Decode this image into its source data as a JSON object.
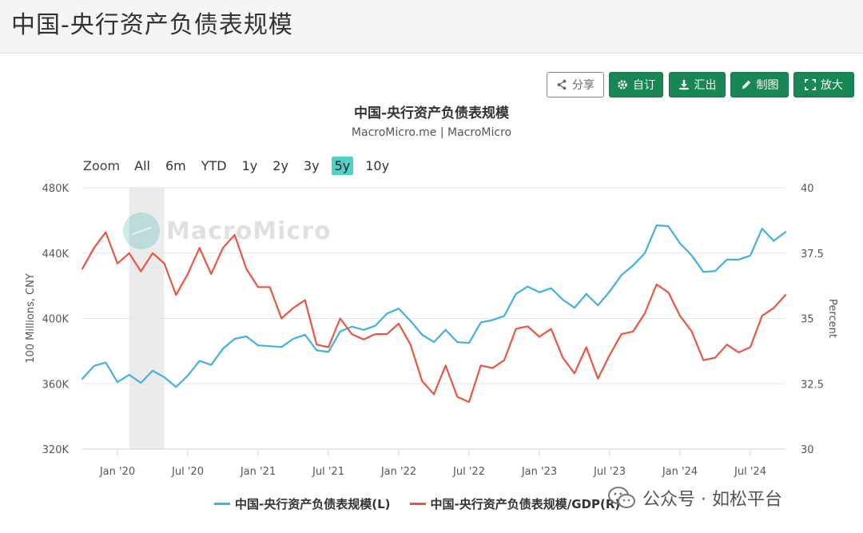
{
  "page": {
    "title": "中国-央行资产负债表规模"
  },
  "toolbar": {
    "share_label": "分享",
    "custom_label": "自订",
    "export_label": "汇出",
    "draw_label": "制图",
    "enlarge_label": "放大"
  },
  "zoom": {
    "label": "Zoom",
    "options": [
      "All",
      "6m",
      "YTD",
      "1y",
      "2y",
      "3y",
      "5y",
      "10y"
    ],
    "active": "5y"
  },
  "watermark": {
    "text": "MacroMicro"
  },
  "wechat": {
    "text": "公众号 · 如松平台"
  },
  "colors": {
    "left_series": "#3fb1e3",
    "right_series": "#e8563f",
    "recession_band": "#ebebeb",
    "active_zoom": "#4fd1c5",
    "button_green": "#198754"
  },
  "chart_data": {
    "type": "line",
    "title": "中国-央行资产负债表规模",
    "subtitle": "MacroMicro.me | MacroMicro",
    "ylabel_left": "100 Millions, CNY",
    "ylabel_right": "Percent",
    "ylim_left": [
      320000,
      480000
    ],
    "ylim_right": [
      30,
      40
    ],
    "yticks_left": [
      "320K",
      "360K",
      "400K",
      "440K",
      "480K"
    ],
    "yticks_right": [
      "30",
      "32.5",
      "35",
      "37.5",
      "40"
    ],
    "yticks_left_values": [
      320000,
      360000,
      400000,
      440000,
      480000
    ],
    "yticks_right_values": [
      30,
      32.5,
      35,
      37.5,
      40
    ],
    "xlim": [
      "2019-10",
      "2024-10"
    ],
    "xticks": [
      {
        "date": "2020-01",
        "label": "Jan '20"
      },
      {
        "date": "2020-07",
        "label": "Jul '20"
      },
      {
        "date": "2021-01",
        "label": "Jan '21"
      },
      {
        "date": "2021-07",
        "label": "Jul '21"
      },
      {
        "date": "2022-01",
        "label": "Jan '22"
      },
      {
        "date": "2022-07",
        "label": "Jul '22"
      },
      {
        "date": "2023-01",
        "label": "Jan '23"
      },
      {
        "date": "2023-07",
        "label": "Jul '23"
      },
      {
        "date": "2024-01",
        "label": "Jan '24"
      },
      {
        "date": "2024-07",
        "label": "Jul '24"
      }
    ],
    "grid": true,
    "legend_position": "bottom",
    "shaded_periods": [
      {
        "start": "2020-02",
        "end": "2020-05"
      }
    ],
    "dates": [
      "2019-10",
      "2019-11",
      "2019-12",
      "2020-01",
      "2020-02",
      "2020-03",
      "2020-04",
      "2020-05",
      "2020-06",
      "2020-07",
      "2020-08",
      "2020-09",
      "2020-10",
      "2020-11",
      "2020-12",
      "2021-01",
      "2021-02",
      "2021-03",
      "2021-04",
      "2021-05",
      "2021-06",
      "2021-07",
      "2021-08",
      "2021-09",
      "2021-10",
      "2021-11",
      "2021-12",
      "2022-01",
      "2022-02",
      "2022-03",
      "2022-04",
      "2022-05",
      "2022-06",
      "2022-07",
      "2022-08",
      "2022-09",
      "2022-10",
      "2022-11",
      "2022-12",
      "2023-01",
      "2023-02",
      "2023-03",
      "2023-04",
      "2023-05",
      "2023-06",
      "2023-07",
      "2023-08",
      "2023-09",
      "2023-10",
      "2023-11",
      "2023-12",
      "2024-01",
      "2024-02",
      "2024-03",
      "2024-04",
      "2024-05",
      "2024-06",
      "2024-07",
      "2024-08",
      "2024-09",
      "2024-10"
    ],
    "series": [
      {
        "name": "中国-央行资产负债表规模(L)",
        "axis": "left",
        "values": [
          363000,
          371000,
          373000,
          361000,
          365500,
          360500,
          368000,
          364000,
          358000,
          365000,
          374000,
          371500,
          381500,
          387500,
          389000,
          383500,
          383000,
          382500,
          387500,
          390000,
          380500,
          379500,
          392000,
          395000,
          393000,
          395500,
          403000,
          406000,
          398500,
          390000,
          385500,
          393000,
          385500,
          385000,
          397500,
          399000,
          401500,
          415000,
          419500,
          416000,
          418500,
          411500,
          406500,
          415000,
          408000,
          416500,
          426500,
          432500,
          440000,
          457000,
          456500,
          446000,
          438500,
          428500,
          429000,
          436000,
          436000,
          438500,
          455000,
          447500,
          453000
        ]
      },
      {
        "name": "中国-央行资产负债表规模/GDP(R)",
        "axis": "right",
        "values": [
          36.9,
          37.7,
          38.3,
          37.1,
          37.5,
          36.8,
          37.5,
          37.1,
          35.9,
          36.7,
          37.7,
          36.7,
          37.7,
          38.2,
          36.9,
          36.2,
          36.2,
          35.0,
          35.4,
          35.7,
          34.0,
          33.9,
          35.0,
          34.4,
          34.2,
          34.4,
          34.4,
          34.8,
          34.0,
          32.6,
          32.1,
          33.2,
          32.0,
          31.8,
          33.2,
          33.1,
          33.4,
          34.6,
          34.7,
          34.3,
          34.6,
          33.5,
          32.9,
          33.9,
          32.7,
          33.6,
          34.4,
          34.5,
          35.2,
          36.3,
          36.0,
          35.1,
          34.5,
          33.4,
          33.5,
          34.0,
          33.7,
          33.9,
          35.1,
          35.4,
          35.9
        ]
      }
    ]
  }
}
